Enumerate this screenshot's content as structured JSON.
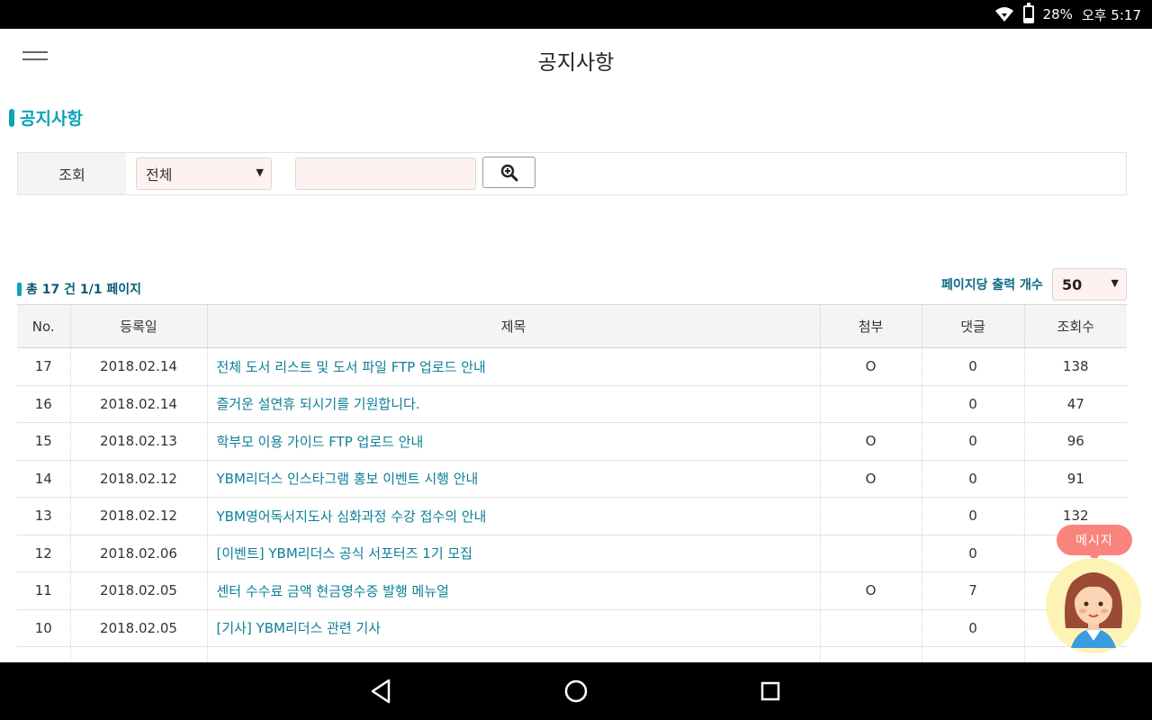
{
  "status_bar": {
    "battery": "28%",
    "time": "오후 5:17",
    "battery_level": 0.28
  },
  "header": {
    "title": "공지사항"
  },
  "section": {
    "title": "공지사항"
  },
  "search": {
    "label": "조회",
    "select_value": "전체",
    "input_value": ""
  },
  "list_meta": {
    "total_text": "총 17 건 1/1 페이지",
    "per_page_label": "페이지당 출력 개수",
    "per_page_value": "50"
  },
  "table": {
    "columns": [
      "No.",
      "등록일",
      "제목",
      "첨부",
      "댓글",
      "조회수"
    ],
    "rows": [
      {
        "no": "17",
        "date": "2018.02.14",
        "title": "전체 도서 리스트 및 도서 파일 FTP 업로드 안내",
        "attach": "O",
        "comments": "0",
        "views": "138"
      },
      {
        "no": "16",
        "date": "2018.02.14",
        "title": "즐거운 설연휴 되시기를 기원합니다.",
        "attach": "",
        "comments": "0",
        "views": "47"
      },
      {
        "no": "15",
        "date": "2018.02.13",
        "title": "학부모 이용 가이드 FTP 업로드 안내",
        "attach": "O",
        "comments": "0",
        "views": "96"
      },
      {
        "no": "14",
        "date": "2018.02.12",
        "title": "YBM리더스 인스타그램 홍보 이벤트 시행 안내",
        "attach": "O",
        "comments": "0",
        "views": "91"
      },
      {
        "no": "13",
        "date": "2018.02.12",
        "title": "YBM영어독서지도사 심화과정 수강 접수의 안내",
        "attach": "",
        "comments": "0",
        "views": "132"
      },
      {
        "no": "12",
        "date": "2018.02.06",
        "title": "[이벤트] YBM리더스 공식 서포터즈 1기 모집",
        "attach": "",
        "comments": "0",
        "views": ""
      },
      {
        "no": "11",
        "date": "2018.02.05",
        "title": "센터 수수료 금액 현금영수증 발행 메뉴얼",
        "attach": "O",
        "comments": "7",
        "views": ""
      },
      {
        "no": "10",
        "date": "2018.02.05",
        "title": "[기사] YBM리더스 관련 기사",
        "attach": "",
        "comments": "0",
        "views": ""
      },
      {
        "no": "",
        "date": "",
        "title": "",
        "attach": "",
        "comments": "",
        "views": ""
      }
    ]
  },
  "chat": {
    "bubble_label": "메시지"
  }
}
